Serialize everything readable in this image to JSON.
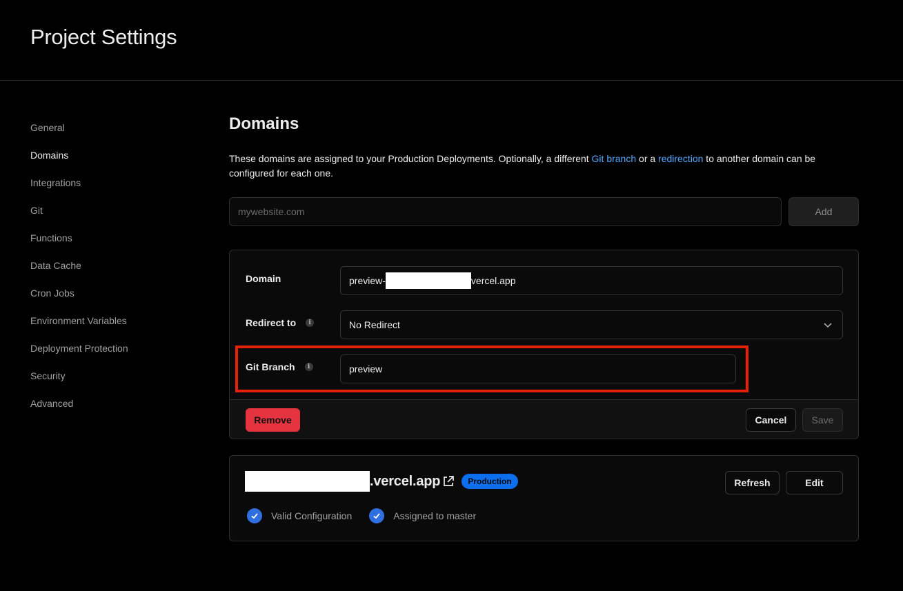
{
  "header": {
    "title": "Project Settings"
  },
  "sidebar": {
    "items": [
      {
        "label": "General",
        "active": false
      },
      {
        "label": "Domains",
        "active": true
      },
      {
        "label": "Integrations",
        "active": false
      },
      {
        "label": "Git",
        "active": false
      },
      {
        "label": "Functions",
        "active": false
      },
      {
        "label": "Data Cache",
        "active": false
      },
      {
        "label": "Cron Jobs",
        "active": false
      },
      {
        "label": "Environment Variables",
        "active": false
      },
      {
        "label": "Deployment Protection",
        "active": false
      },
      {
        "label": "Security",
        "active": false
      },
      {
        "label": "Advanced",
        "active": false
      }
    ]
  },
  "domains": {
    "title": "Domains",
    "description_part1": "These domains are assigned to your Production Deployments. Optionally, a different ",
    "link_git_branch": "Git branch",
    "description_part2": " or a ",
    "link_redirection": "redirection",
    "description_part3": " to another domain can be configured for each one.",
    "input_placeholder": "mywebsite.com",
    "add_label": "Add"
  },
  "edit_form": {
    "domain_label": "Domain",
    "domain_prefix": "preview-",
    "domain_suffix": "vercel.app",
    "redirect_label": "Redirect to",
    "redirect_value": "No Redirect",
    "git_branch_label": "Git Branch",
    "git_branch_value": "preview",
    "remove_label": "Remove",
    "cancel_label": "Cancel",
    "save_label": "Save"
  },
  "domain_entry": {
    "suffix": ".vercel.app",
    "badge": "Production",
    "refresh_label": "Refresh",
    "edit_label": "Edit",
    "status": [
      "Valid Configuration",
      "Assigned to master"
    ]
  },
  "colors": {
    "accent": "#52a8ff",
    "badge": "#0b6ff0",
    "danger": "#e5343f",
    "highlight": "#e8200a",
    "check": "#2f6fe0"
  }
}
